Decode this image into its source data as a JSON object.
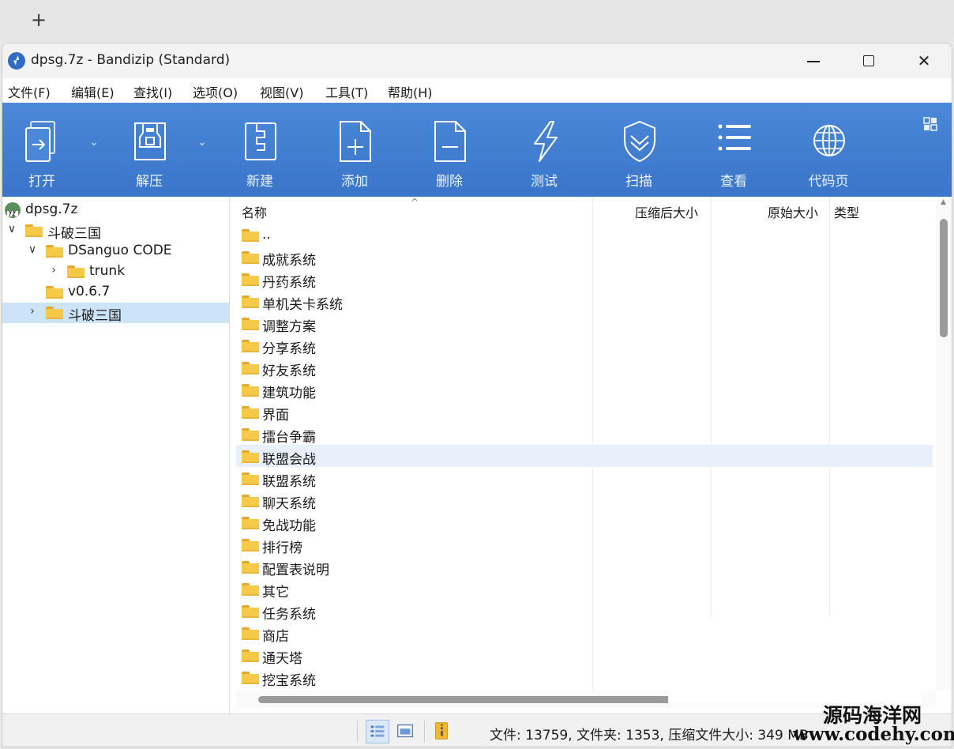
{
  "browser": {
    "new_tab": "+"
  },
  "window": {
    "title": "dpsg.7z - Bandizip (Standard)",
    "controls": {
      "close": "✕"
    }
  },
  "menu": [
    "文件(F)",
    "编辑(E)",
    "查找(I)",
    "选项(O)",
    "视图(V)",
    "工具(T)",
    "帮助(H)"
  ],
  "toolbar": {
    "dropdown_glyph": "⌄",
    "items": [
      {
        "label": "打开",
        "icon": "open-icon"
      },
      {
        "label": "解压",
        "icon": "extract-icon"
      },
      {
        "label": "新建",
        "icon": "new-archive-icon"
      },
      {
        "label": "添加",
        "icon": "add-file-icon"
      },
      {
        "label": "删除",
        "icon": "delete-file-icon"
      },
      {
        "label": "测试",
        "icon": "lightning-icon"
      },
      {
        "label": "扫描",
        "icon": "shield-icon"
      },
      {
        "label": "查看",
        "icon": "list-view-icon"
      },
      {
        "label": "代码页",
        "icon": "globe-icon"
      }
    ]
  },
  "tree": {
    "items": [
      {
        "label": "dpsg.7z",
        "chevron": ""
      },
      {
        "label": "斗破三国",
        "chevron": "∨"
      },
      {
        "label": "DSanguo CODE",
        "chevron": "∨"
      },
      {
        "label": "trunk",
        "chevron": "›"
      },
      {
        "label": "v0.6.7",
        "chevron": ""
      },
      {
        "label": "斗破三国",
        "chevron": "›",
        "selected": true
      }
    ]
  },
  "file_list": {
    "sort_indicator": "^",
    "columns": [
      "名称",
      "压缩后大小",
      "原始大小",
      "类型"
    ],
    "rows": [
      "..",
      "成就系统",
      "丹药系统",
      "单机关卡系统",
      "调整方案",
      "分享系统",
      "好友系统",
      "建筑功能",
      "界面",
      "擂台争霸",
      "联盟会战",
      "联盟系统",
      "聊天系统",
      "免战功能",
      "排行榜",
      "配置表说明",
      "其它",
      "任务系统",
      "商店",
      "通天塔",
      "挖宝系统"
    ],
    "hover_row": "联盟会战"
  },
  "scrollbar": {
    "up_arrow": "▲"
  },
  "status": {
    "text": "文件: 13759, 文件夹: 1353, 压缩文件大小: 349 MB"
  },
  "watermark": {
    "line1": "源码海洋网",
    "line2": "www.codehy.com"
  },
  "colors": {
    "toolbar": "#3f7ccd",
    "selection": "#cce4f7",
    "folder": "#f7c949"
  }
}
